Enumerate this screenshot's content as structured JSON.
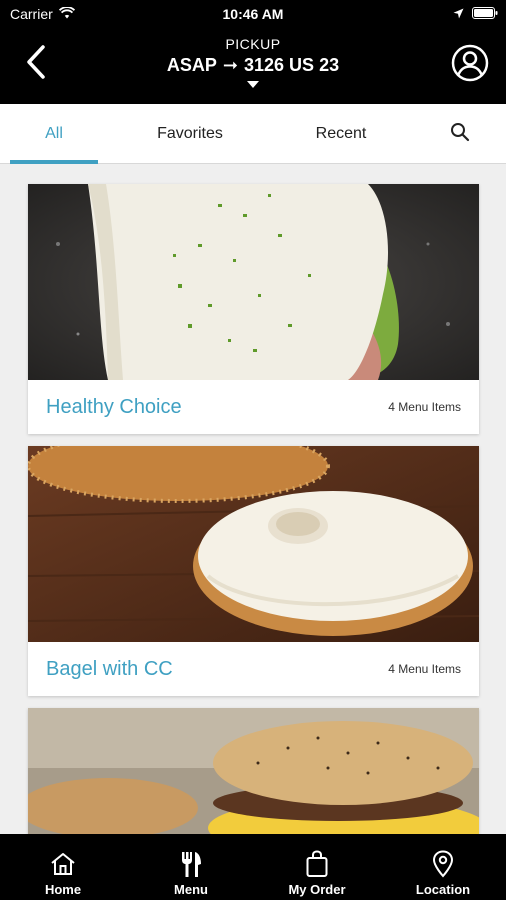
{
  "status_bar": {
    "carrier": "Carrier",
    "time": "10:46 AM"
  },
  "header": {
    "pickup_label": "PICKUP",
    "timing": "ASAP",
    "arrow": "➞",
    "location": "3126 US 23"
  },
  "tabs": [
    {
      "label": "All",
      "active": true
    },
    {
      "label": "Favorites",
      "active": false
    },
    {
      "label": "Recent",
      "active": false
    }
  ],
  "categories": [
    {
      "title": "Healthy Choice",
      "count": "4 Menu Items"
    },
    {
      "title": "Bagel with CC",
      "count": "4 Menu Items"
    },
    {
      "title": "",
      "count": ""
    }
  ],
  "bottom_nav": [
    {
      "label": "Home",
      "icon": "home-icon"
    },
    {
      "label": "Menu",
      "icon": "fork-knife-icon"
    },
    {
      "label": "My Order",
      "icon": "bag-icon"
    },
    {
      "label": "Location",
      "icon": "location-pin-icon"
    }
  ],
  "colors": {
    "accent": "#3fa0c2",
    "header_bg": "#000000",
    "list_bg": "#efefef"
  }
}
